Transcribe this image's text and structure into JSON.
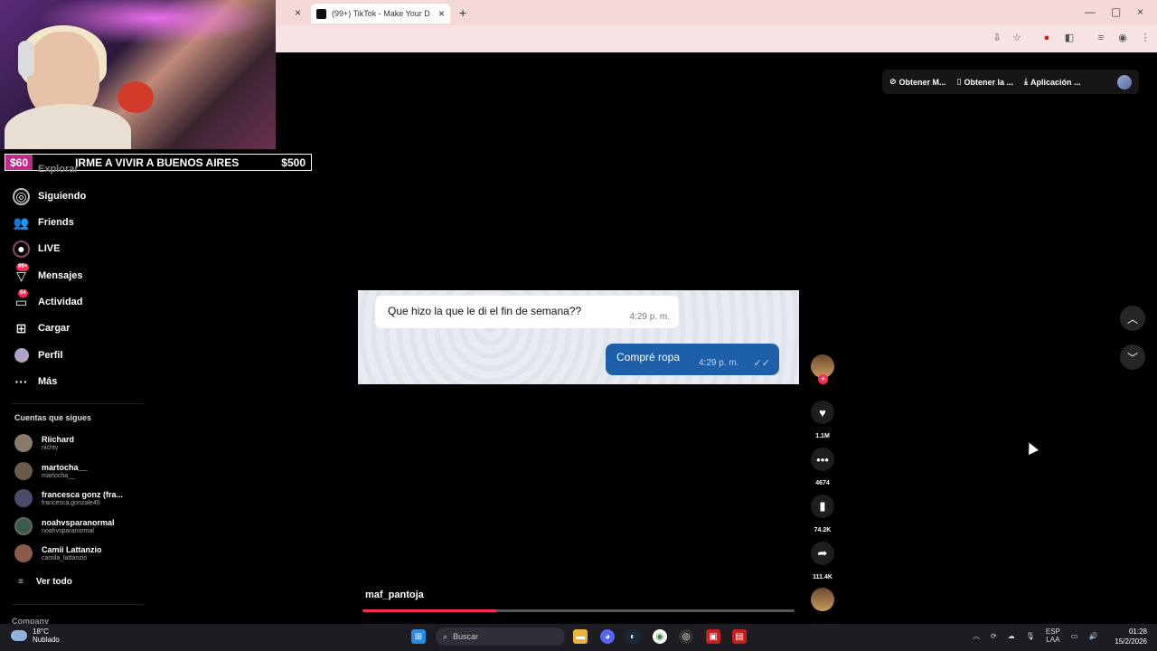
{
  "browser": {
    "tab_title": "(99+) TikTok - Make Your D",
    "tab_close": "×",
    "new_tab": "+",
    "other_tab_close": "×",
    "window_controls": [
      "—",
      "▢",
      "×"
    ]
  },
  "goal": {
    "current": "$60",
    "title": "IRME A VIVIR A BUENOS AIRES",
    "target": "$500"
  },
  "sidebar": {
    "explore_label": "Explorar",
    "items": [
      {
        "label": "Siguiendo",
        "icon": "following-icon"
      },
      {
        "label": "Friends",
        "icon": "friends-icon"
      },
      {
        "label": "LIVE",
        "icon": "live-icon"
      },
      {
        "label": "Mensajes",
        "icon": "messages-icon",
        "badge": "99+"
      },
      {
        "label": "Actividad",
        "icon": "activity-icon",
        "badge": "54"
      },
      {
        "label": "Cargar",
        "icon": "upload-icon"
      },
      {
        "label": "Perfil",
        "icon": "profile-icon"
      },
      {
        "label": "Más",
        "icon": "more-icon"
      }
    ],
    "following_heading": "Cuentas que sigues",
    "accounts": [
      {
        "name": "Riichard",
        "handle": "riichtv"
      },
      {
        "name": "martocha__",
        "handle": "martocha__"
      },
      {
        "name": "francesca gonz (fra...",
        "handle": "francesca.gonzale40"
      },
      {
        "name": "noahvsparanormal",
        "handle": "noahvsparanormal"
      },
      {
        "name": "Camii Lattanzio",
        "handle": "camila_lattanzio"
      }
    ],
    "see_all": "Ver todo",
    "company": "Company"
  },
  "topbar": {
    "coins": "Obtener M...",
    "app": "Obtener la ...",
    "desktop": "Aplicación ..."
  },
  "video": {
    "incoming_text": "Que hizo la que le di el fin de semana??",
    "incoming_time": "4:29 p. m.",
    "outgoing_text": "Compré ropa",
    "outgoing_time": "4:29 p. m.",
    "author": "maf_pantoja",
    "progress": 0.31
  },
  "actions": {
    "likes": "1.1M",
    "comments": "4674",
    "saves": "74.2K",
    "shares": "111.4K"
  },
  "taskbar": {
    "temp": "18°C",
    "weather": "Nublado",
    "search": "Buscar",
    "lang1": "ESP",
    "lang2": "LAA",
    "time": "01:28",
    "date": "15/2/2026"
  }
}
